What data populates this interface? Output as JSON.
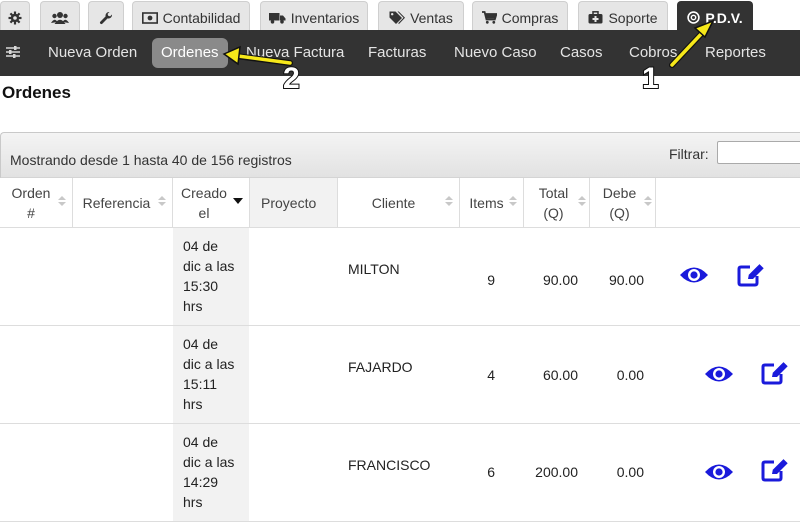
{
  "top_tabs": [
    {
      "id": "settings",
      "label": "",
      "icon": "gear-icon"
    },
    {
      "id": "users",
      "label": "",
      "icon": "users-icon"
    },
    {
      "id": "tools",
      "label": "",
      "icon": "wrench-icon"
    },
    {
      "id": "contabilidad",
      "label": "Contabilidad",
      "icon": "money-icon"
    },
    {
      "id": "inventarios",
      "label": "Inventarios",
      "icon": "truck-icon"
    },
    {
      "id": "ventas",
      "label": "Ventas",
      "icon": "tags-icon"
    },
    {
      "id": "compras",
      "label": "Compras",
      "icon": "cart-icon"
    },
    {
      "id": "soporte",
      "label": "Soporte",
      "icon": "medkit-icon"
    },
    {
      "id": "pdv",
      "label": "P.D.V.",
      "icon": "disc-icon",
      "active": true
    }
  ],
  "menu": {
    "items": [
      {
        "label": "Nueva Orden"
      },
      {
        "label": "Ordenes",
        "active": true
      },
      {
        "label": "Nueva Factura"
      },
      {
        "label": "Facturas"
      },
      {
        "label": "Nuevo Caso"
      },
      {
        "label": "Casos"
      },
      {
        "label": "Cobros"
      },
      {
        "label": "Reportes"
      }
    ]
  },
  "page": {
    "title": "Ordenes"
  },
  "table": {
    "showing_text": "Mostrando desde 1 hasta 40 de 156 registros",
    "filter_label": "Filtrar:",
    "filter_value": "",
    "columns": [
      {
        "l1": "Orden",
        "l2": "#"
      },
      {
        "l1": "Referencia",
        "l2": ""
      },
      {
        "l1": "Creado",
        "l2": "el"
      },
      {
        "l1": "Proyecto",
        "l2": ""
      },
      {
        "l1": "Cliente",
        "l2": ""
      },
      {
        "l1": "Items",
        "l2": ""
      },
      {
        "l1": "Total",
        "l2": "(Q)"
      },
      {
        "l1": "Debe",
        "l2": "(Q)"
      }
    ],
    "rows": [
      {
        "orden": "",
        "referencia": "",
        "created": [
          "04 de",
          "dic a las",
          "15:30",
          "hrs"
        ],
        "proyecto": "",
        "cliente": "MILTON",
        "items": "9",
        "total": "90.00",
        "debe": "90.00"
      },
      {
        "orden": "",
        "referencia": "",
        "created": [
          "04 de",
          "dic a las",
          "15:11",
          "hrs"
        ],
        "proyecto": "",
        "cliente": "FAJARDO",
        "items": "4",
        "total": "60.00",
        "debe": "0.00"
      },
      {
        "orden": "",
        "referencia": "",
        "created": [
          "04 de",
          "dic a las",
          "14:29",
          "hrs"
        ],
        "proyecto": "",
        "cliente": "FRANCISCO",
        "items": "6",
        "total": "200.00",
        "debe": "0.00"
      }
    ]
  },
  "annotations": {
    "one": "1",
    "two": "2"
  },
  "colors": {
    "accent_arrow": "#f6e81a",
    "action_icon": "#1a1adb",
    "menu_bg": "#333333"
  }
}
